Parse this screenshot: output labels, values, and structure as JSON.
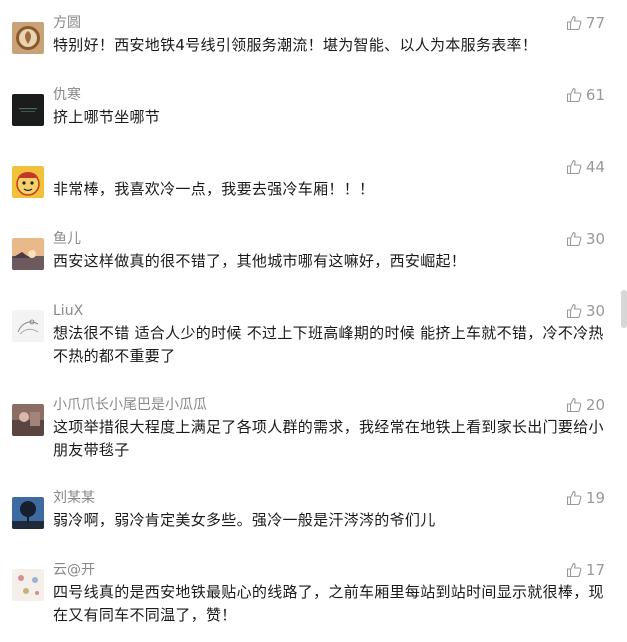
{
  "comments": [
    {
      "nickname": "方圆",
      "content": "特别好！西安地铁4号线引领服务潮流！堪为智能、以人为本服务表率！",
      "likes": "77",
      "avatar_icon": "coffee-latte-avatar"
    },
    {
      "nickname": "仇寒",
      "content": "挤上哪节坐哪节",
      "likes": "61",
      "avatar_icon": "dark-logo-avatar"
    },
    {
      "nickname": "",
      "content": "非常棒，我喜欢冷一点，我要去强冷车厢！！！",
      "likes": "44",
      "avatar_icon": "cartoon-face-avatar"
    },
    {
      "nickname": "鱼儿",
      "content": "西安这样做真的很不错了，其他城市哪有这嘛好，西安崛起！",
      "likes": "30",
      "avatar_icon": "sunset-avatar"
    },
    {
      "nickname": "LiuX",
      "content": "想法很不错 适合人少的时候 不过上下班高峰期的时候 能挤上车就不错，冷不冷热不热的都不重要了",
      "likes": "30",
      "avatar_icon": "sketch-avatar"
    },
    {
      "nickname": "小爪爪长小尾巴是小瓜瓜",
      "content": "这项举措很大程度上满足了各项人群的需求，我经常在地铁上看到家长出门要给小朋友带毯子",
      "likes": "20",
      "avatar_icon": "photo-avatar"
    },
    {
      "nickname": "刘某某",
      "content": "弱冷啊，弱冷肯定美女多些。强冷一般是汗涔涔的爷们儿",
      "likes": "19",
      "avatar_icon": "tree-silhouette-avatar"
    },
    {
      "nickname": "云@开",
      "content": "四号线真的是西安地铁最贴心的线路了，之前车厢里每站到站时间显示就很棒，现在又有同车不同温了，赞！",
      "likes": "17",
      "avatar_icon": "pattern-avatar"
    }
  ],
  "colors": {
    "nickname": "#888888",
    "content": "#1a1a1a",
    "like_icon": "#999999"
  }
}
